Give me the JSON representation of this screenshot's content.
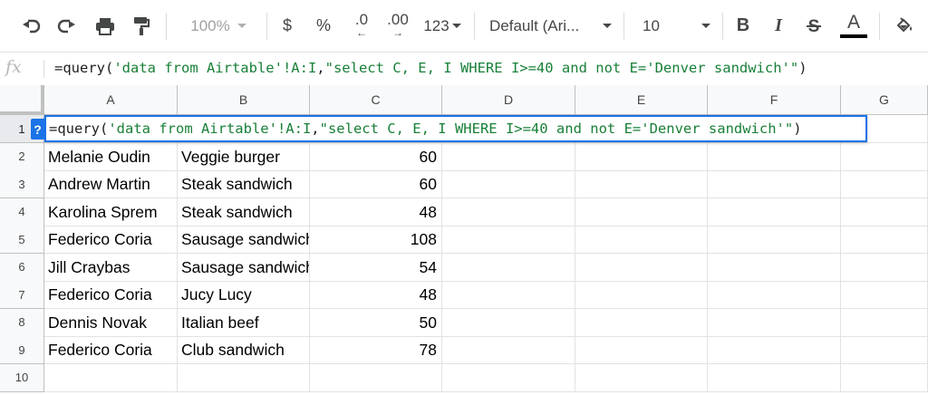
{
  "toolbar": {
    "zoom": "100%",
    "currency": "$",
    "percent": "%",
    "decrease_decimals": ".0",
    "increase_decimals": ".00",
    "more_formats": "123",
    "font_family": "Default (Ari...",
    "font_size": "10",
    "bold": "B",
    "italic": "I",
    "text_color": "A"
  },
  "formula_bar": {
    "fx_label": "fx",
    "parts": [
      "=query(",
      "'data from Airtable'!A:I",
      ",",
      "\"select C, E, I WHERE I>=40 and not E='Denver sandwich'\"",
      ")"
    ]
  },
  "grid": {
    "columns": [
      "A",
      "B",
      "C",
      "D",
      "E",
      "F",
      "G"
    ],
    "rows": [
      "1",
      "2",
      "3",
      "4",
      "5",
      "6",
      "7",
      "8",
      "9",
      "10"
    ],
    "help_badge": "?",
    "data": [
      [
        "Melanie Oudin",
        "Veggie burger",
        "60"
      ],
      [
        "Andrew Martin",
        "Steak sandwich",
        "60"
      ],
      [
        "Karolina Sprem",
        "Steak sandwich",
        "48"
      ],
      [
        "Federico Coria",
        "Sausage sandwich",
        "108"
      ],
      [
        "Jill Craybas",
        "Sausage sandwich",
        "54"
      ],
      [
        "Federico Coria",
        "Jucy Lucy",
        "48"
      ],
      [
        "Dennis Novak",
        "Italian beef",
        "50"
      ],
      [
        "Federico Coria",
        "Club sandwich",
        "78"
      ]
    ]
  },
  "colors": {
    "accent": "#1a73e8",
    "string_green": "#188038"
  }
}
